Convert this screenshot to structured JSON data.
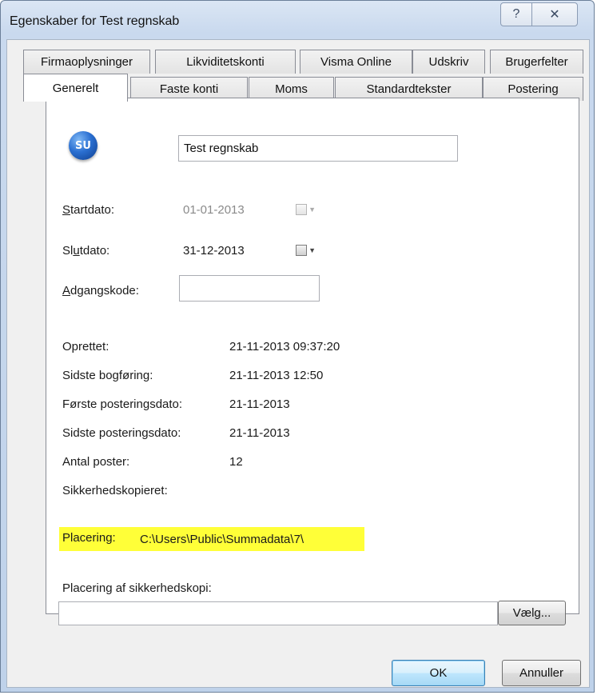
{
  "window": {
    "title": "Egenskaber for Test regnskab",
    "help_glyph": "?",
    "close_glyph": "✕"
  },
  "tabs": {
    "row1": [
      "Firmaoplysninger",
      "Likviditetskonti",
      "Visma Online",
      "Udskriv",
      "Brugerfelter"
    ],
    "row2": [
      "Generelt",
      "Faste konti",
      "Moms",
      "Standardtekster",
      "Postering"
    ],
    "active": "Generelt"
  },
  "general": {
    "logo_text": "SU",
    "company_name": "Test regnskab",
    "startdato": {
      "label_pre": "",
      "label_ul": "S",
      "label_post": "tartdato:",
      "value": "01-01-2013",
      "enabled": false
    },
    "slutdato": {
      "label_pre": "Sl",
      "label_ul": "u",
      "label_post": "tdato:",
      "value": "31-12-2013",
      "enabled": true
    },
    "adgangskode": {
      "label_pre": "",
      "label_ul": "A",
      "label_post": "dgangskode:",
      "value": ""
    },
    "info": [
      {
        "label": "Oprettet:",
        "value": "21-11-2013 09:37:20"
      },
      {
        "label": "Sidste bogføring:",
        "value": "21-11-2013 12:50"
      },
      {
        "label": "Første posteringsdato:",
        "value": "21-11-2013"
      },
      {
        "label": "Sidste posteringsdato:",
        "value": "21-11-2013"
      },
      {
        "label": "Antal poster:",
        "value": "12"
      },
      {
        "label": "Sikkerhedskopieret:",
        "value": ""
      }
    ],
    "placering_label": "Placering:",
    "placering_value": "C:\\Users\\Public\\Summadata\\7\\",
    "backup_label": "Placering af sikkerhedskopi:",
    "backup_value": "",
    "choose_button": "Vælg...",
    "highlight_color": "#ffff38"
  },
  "footer": {
    "ok": "OK",
    "cancel": "Annuller"
  }
}
